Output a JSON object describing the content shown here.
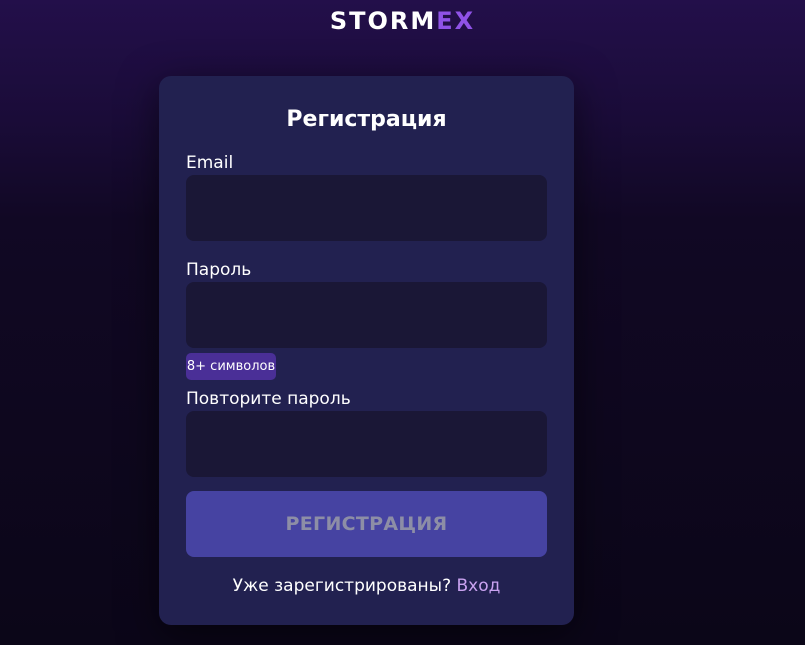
{
  "logo": {
    "part1": "STORM",
    "part2": "EX",
    "accent_color": "#8f52e6"
  },
  "form": {
    "title": "Регистрация",
    "email_label": "Email",
    "email_value": "",
    "password_label": "Пароль",
    "password_value": "",
    "password_hint": "8+ символов",
    "repeat_label": "Повторите пароль",
    "repeat_value": "",
    "submit_label": "РЕГИСТРАЦИЯ",
    "footer_text": "Уже зарегистрированы?",
    "login_link": "Вход"
  }
}
